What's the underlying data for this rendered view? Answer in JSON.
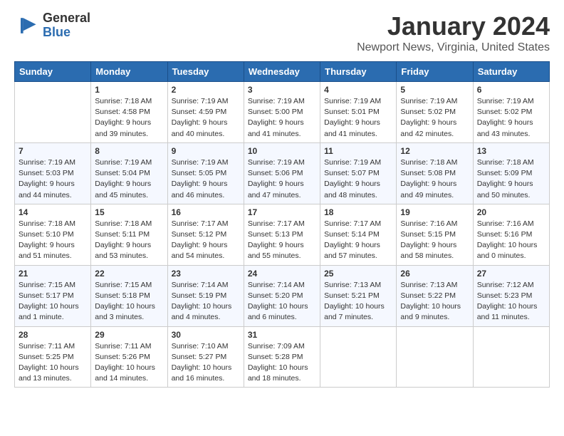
{
  "logo": {
    "general": "General",
    "blue": "Blue"
  },
  "title": "January 2024",
  "location": "Newport News, Virginia, United States",
  "days_header": [
    "Sunday",
    "Monday",
    "Tuesday",
    "Wednesday",
    "Thursday",
    "Friday",
    "Saturday"
  ],
  "weeks": [
    [
      {
        "day": "",
        "info": ""
      },
      {
        "day": "1",
        "info": "Sunrise: 7:18 AM\nSunset: 4:58 PM\nDaylight: 9 hours\nand 39 minutes."
      },
      {
        "day": "2",
        "info": "Sunrise: 7:19 AM\nSunset: 4:59 PM\nDaylight: 9 hours\nand 40 minutes."
      },
      {
        "day": "3",
        "info": "Sunrise: 7:19 AM\nSunset: 5:00 PM\nDaylight: 9 hours\nand 41 minutes."
      },
      {
        "day": "4",
        "info": "Sunrise: 7:19 AM\nSunset: 5:01 PM\nDaylight: 9 hours\nand 41 minutes."
      },
      {
        "day": "5",
        "info": "Sunrise: 7:19 AM\nSunset: 5:02 PM\nDaylight: 9 hours\nand 42 minutes."
      },
      {
        "day": "6",
        "info": "Sunrise: 7:19 AM\nSunset: 5:02 PM\nDaylight: 9 hours\nand 43 minutes."
      }
    ],
    [
      {
        "day": "7",
        "info": "Sunrise: 7:19 AM\nSunset: 5:03 PM\nDaylight: 9 hours\nand 44 minutes."
      },
      {
        "day": "8",
        "info": "Sunrise: 7:19 AM\nSunset: 5:04 PM\nDaylight: 9 hours\nand 45 minutes."
      },
      {
        "day": "9",
        "info": "Sunrise: 7:19 AM\nSunset: 5:05 PM\nDaylight: 9 hours\nand 46 minutes."
      },
      {
        "day": "10",
        "info": "Sunrise: 7:19 AM\nSunset: 5:06 PM\nDaylight: 9 hours\nand 47 minutes."
      },
      {
        "day": "11",
        "info": "Sunrise: 7:19 AM\nSunset: 5:07 PM\nDaylight: 9 hours\nand 48 minutes."
      },
      {
        "day": "12",
        "info": "Sunrise: 7:18 AM\nSunset: 5:08 PM\nDaylight: 9 hours\nand 49 minutes."
      },
      {
        "day": "13",
        "info": "Sunrise: 7:18 AM\nSunset: 5:09 PM\nDaylight: 9 hours\nand 50 minutes."
      }
    ],
    [
      {
        "day": "14",
        "info": "Sunrise: 7:18 AM\nSunset: 5:10 PM\nDaylight: 9 hours\nand 51 minutes."
      },
      {
        "day": "15",
        "info": "Sunrise: 7:18 AM\nSunset: 5:11 PM\nDaylight: 9 hours\nand 53 minutes."
      },
      {
        "day": "16",
        "info": "Sunrise: 7:17 AM\nSunset: 5:12 PM\nDaylight: 9 hours\nand 54 minutes."
      },
      {
        "day": "17",
        "info": "Sunrise: 7:17 AM\nSunset: 5:13 PM\nDaylight: 9 hours\nand 55 minutes."
      },
      {
        "day": "18",
        "info": "Sunrise: 7:17 AM\nSunset: 5:14 PM\nDaylight: 9 hours\nand 57 minutes."
      },
      {
        "day": "19",
        "info": "Sunrise: 7:16 AM\nSunset: 5:15 PM\nDaylight: 9 hours\nand 58 minutes."
      },
      {
        "day": "20",
        "info": "Sunrise: 7:16 AM\nSunset: 5:16 PM\nDaylight: 10 hours\nand 0 minutes."
      }
    ],
    [
      {
        "day": "21",
        "info": "Sunrise: 7:15 AM\nSunset: 5:17 PM\nDaylight: 10 hours\nand 1 minute."
      },
      {
        "day": "22",
        "info": "Sunrise: 7:15 AM\nSunset: 5:18 PM\nDaylight: 10 hours\nand 3 minutes."
      },
      {
        "day": "23",
        "info": "Sunrise: 7:14 AM\nSunset: 5:19 PM\nDaylight: 10 hours\nand 4 minutes."
      },
      {
        "day": "24",
        "info": "Sunrise: 7:14 AM\nSunset: 5:20 PM\nDaylight: 10 hours\nand 6 minutes."
      },
      {
        "day": "25",
        "info": "Sunrise: 7:13 AM\nSunset: 5:21 PM\nDaylight: 10 hours\nand 7 minutes."
      },
      {
        "day": "26",
        "info": "Sunrise: 7:13 AM\nSunset: 5:22 PM\nDaylight: 10 hours\nand 9 minutes."
      },
      {
        "day": "27",
        "info": "Sunrise: 7:12 AM\nSunset: 5:23 PM\nDaylight: 10 hours\nand 11 minutes."
      }
    ],
    [
      {
        "day": "28",
        "info": "Sunrise: 7:11 AM\nSunset: 5:25 PM\nDaylight: 10 hours\nand 13 minutes."
      },
      {
        "day": "29",
        "info": "Sunrise: 7:11 AM\nSunset: 5:26 PM\nDaylight: 10 hours\nand 14 minutes."
      },
      {
        "day": "30",
        "info": "Sunrise: 7:10 AM\nSunset: 5:27 PM\nDaylight: 10 hours\nand 16 minutes."
      },
      {
        "day": "31",
        "info": "Sunrise: 7:09 AM\nSunset: 5:28 PM\nDaylight: 10 hours\nand 18 minutes."
      },
      {
        "day": "",
        "info": ""
      },
      {
        "day": "",
        "info": ""
      },
      {
        "day": "",
        "info": ""
      }
    ]
  ]
}
